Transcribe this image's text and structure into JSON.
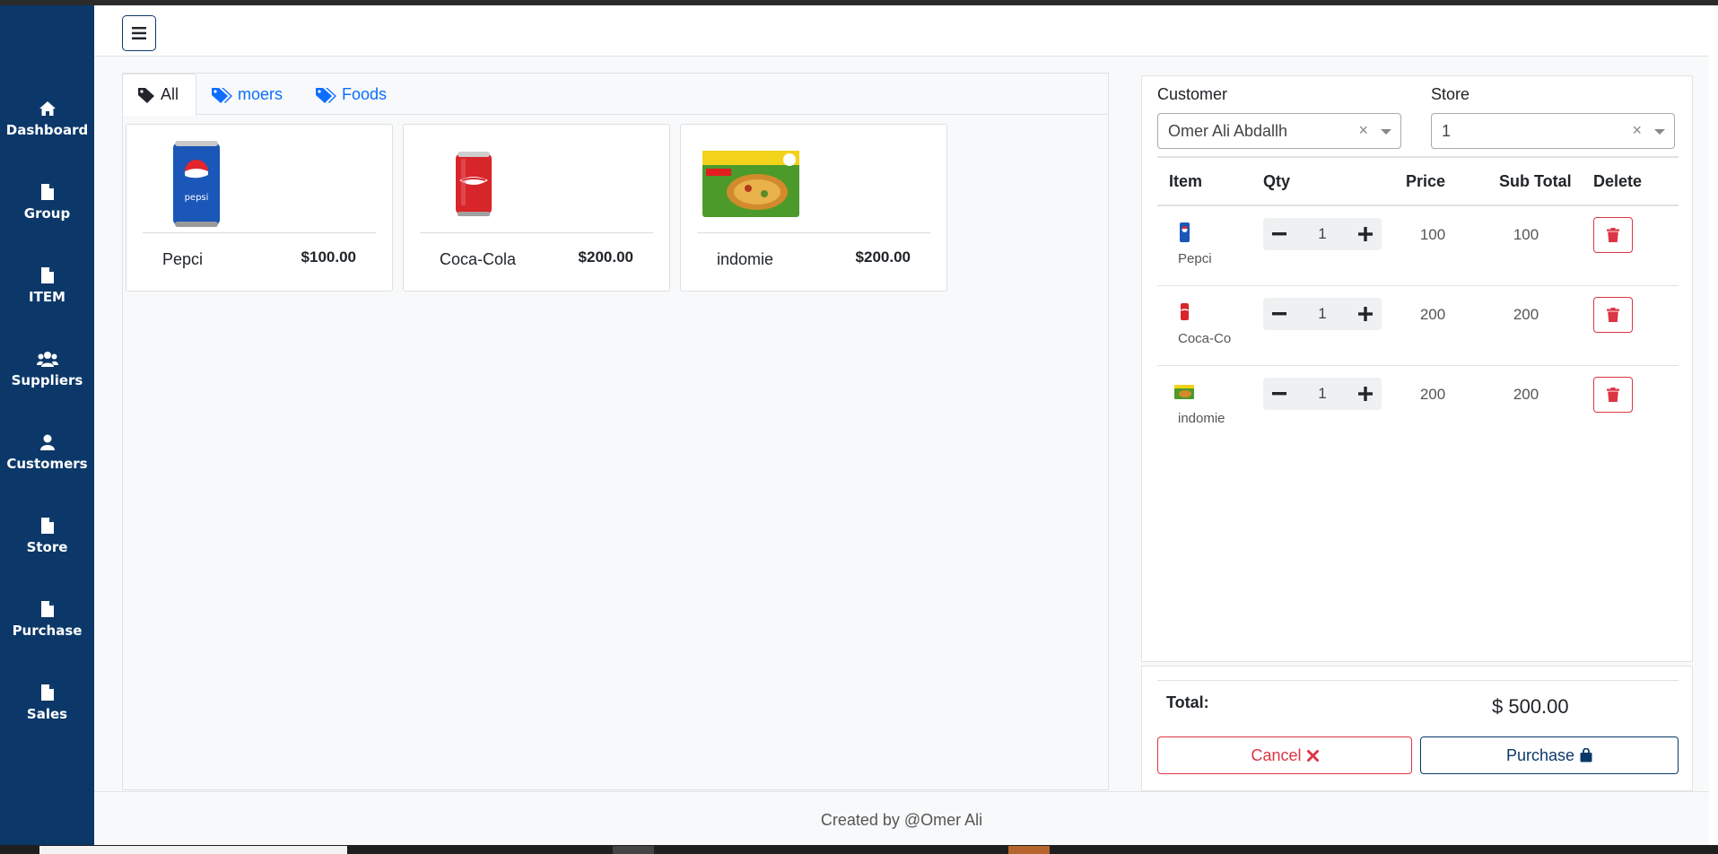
{
  "sidebar": {
    "items": [
      {
        "label": "Dashboard",
        "icon": "home-icon"
      },
      {
        "label": "Group",
        "icon": "file-icon"
      },
      {
        "label": "ITEM",
        "icon": "file-icon"
      },
      {
        "label": "Suppliers",
        "icon": "users-icon"
      },
      {
        "label": "Customers",
        "icon": "user-icon"
      },
      {
        "label": "Store",
        "icon": "file-icon"
      },
      {
        "label": "Purchase",
        "icon": "file-icon"
      },
      {
        "label": "Sales",
        "icon": "file-icon"
      }
    ]
  },
  "header": {
    "menu_icon": "hamburger-icon"
  },
  "tabs": [
    {
      "label": "All",
      "active": true
    },
    {
      "label": "moers",
      "active": false
    },
    {
      "label": "Foods",
      "active": false
    }
  ],
  "products": [
    {
      "name": "Pepci",
      "price": "$100.00",
      "image": "pepsi-can"
    },
    {
      "name": "Coca-Cola",
      "price": "$200.00",
      "image": "coca-cola-can"
    },
    {
      "name": "indomie",
      "price": "$200.00",
      "image": "indomie-pack"
    }
  ],
  "cart": {
    "customer_label": "Customer",
    "customer_value": "Omer Ali Abdallh",
    "store_label": "Store",
    "store_value": "1",
    "clear_glyph": "×",
    "columns": [
      "Item",
      "Qty",
      "Price",
      "Sub Total",
      "Delete"
    ],
    "rows": [
      {
        "name": "Pepci",
        "qty": "1",
        "price": "100",
        "subtotal": "100"
      },
      {
        "name": "Coca-Co",
        "qty": "1",
        "price": "200",
        "subtotal": "200"
      },
      {
        "name": "indomie",
        "qty": "1",
        "price": "200",
        "subtotal": "200"
      }
    ],
    "total_label": "Total:",
    "total_value": "$ 500.00",
    "cancel_label": "Cancel",
    "purchase_label": "Purchase"
  },
  "footer": {
    "text": "Created by @Omer Ali"
  },
  "colors": {
    "sidebar": "#0b3869",
    "link": "#0d6efd",
    "danger": "#dc3545"
  }
}
